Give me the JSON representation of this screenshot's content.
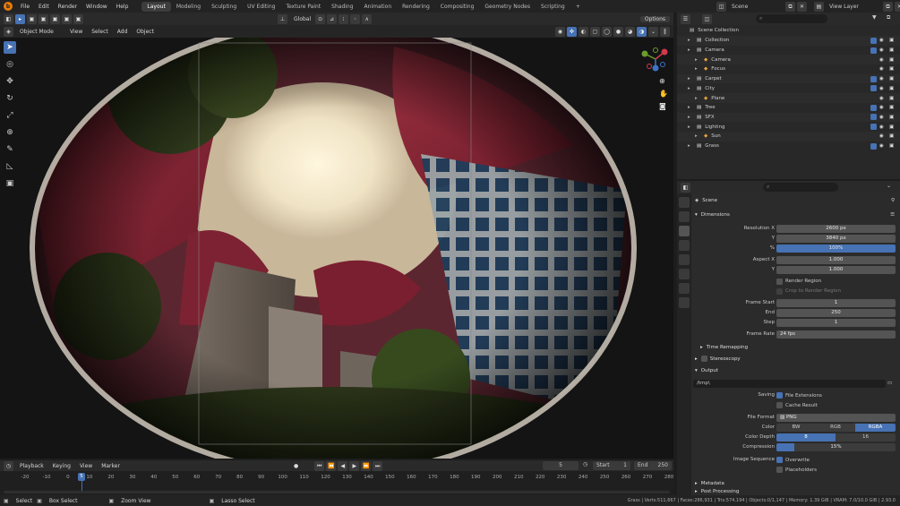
{
  "menu": {
    "items": [
      "File",
      "Edit",
      "Render",
      "Window",
      "Help"
    ]
  },
  "workspaces": [
    "Layout",
    "Modeling",
    "Sculpting",
    "UV Editing",
    "Texture Paint",
    "Shading",
    "Animation",
    "Rendering",
    "Compositing",
    "Geometry Nodes",
    "Scripting"
  ],
  "topright": {
    "scene": "Scene",
    "view_layer": "View Layer"
  },
  "viewport": {
    "orientation": "Global",
    "options_label": "Options",
    "mode": "Object Mode",
    "menus": [
      "View",
      "Select",
      "Add",
      "Object"
    ]
  },
  "outliner": {
    "root": "Scene Collection",
    "items": [
      {
        "label": "Collection",
        "depth": 1
      },
      {
        "label": "Camera",
        "depth": 1
      },
      {
        "label": "Camera",
        "depth": 2
      },
      {
        "label": "Focus",
        "depth": 2
      },
      {
        "label": "Carpet",
        "depth": 1
      },
      {
        "label": "City",
        "depth": 1
      },
      {
        "label": "Plane",
        "depth": 2
      },
      {
        "label": "Tree",
        "depth": 1
      },
      {
        "label": "SFX",
        "depth": 1
      },
      {
        "label": "Lighting",
        "depth": 1
      },
      {
        "label": "Sun",
        "depth": 2
      },
      {
        "label": "Grass",
        "depth": 1
      }
    ]
  },
  "properties": {
    "scene_label": "Scene",
    "dimensions": {
      "title": "Dimensions",
      "resolution_x_label": "Resolution X",
      "resolution_x": "2600 px",
      "y_label": "Y",
      "resolution_y": "3840 px",
      "percent_label": "%",
      "percent": "100%",
      "aspect_x_label": "Aspect X",
      "aspect_x": "1.000",
      "aspect_y_label": "Y",
      "aspect_y": "1.000",
      "render_region": "Render Region",
      "crop_region": "Crop to Render Region",
      "frame_start_label": "Frame Start",
      "frame_start": "1",
      "end_label": "End",
      "end": "250",
      "step_label": "Step",
      "step": "1",
      "frame_rate_label": "Frame Rate",
      "frame_rate": "24 fps",
      "time_remapping": "Time Remapping"
    },
    "stereoscopy": "Stereoscopy",
    "output": {
      "title": "Output",
      "path": "/tmp\\",
      "saving_label": "Saving",
      "file_extensions": "File Extensions",
      "cache_result": "Cache Result",
      "file_format_label": "File Format",
      "file_format": "PNG",
      "color_label": "Color",
      "color_options": [
        "BW",
        "RGB",
        "RGBA"
      ],
      "color_depth_label": "Color Depth",
      "color_depth": [
        "8",
        "16"
      ],
      "compression_label": "Compression",
      "compression": "15%",
      "image_sequence_label": "Image Sequence",
      "overwrite": "Overwrite",
      "placeholders": "Placeholders"
    },
    "metadata": "Metadata",
    "post_processing": "Post Processing"
  },
  "timeline": {
    "menus": [
      "Playback",
      "Keying",
      "View",
      "Marker"
    ],
    "current_frame": "5",
    "start_label": "Start",
    "start": "1",
    "end_label": "End",
    "end": "250",
    "ticks": [
      "-20",
      "-10",
      "0",
      "10",
      "20",
      "30",
      "40",
      "50",
      "60",
      "70",
      "80",
      "90",
      "100",
      "110",
      "120",
      "130",
      "140",
      "150",
      "160",
      "170",
      "180",
      "190",
      "200",
      "210",
      "220",
      "230",
      "240",
      "250",
      "260",
      "270",
      "280"
    ],
    "playhead": "5"
  },
  "statusbar": {
    "select": "Select",
    "box_select": "Box Select",
    "zoom_view": "Zoom View",
    "lasso_select": "Lasso Select",
    "stats": "Grass | Verts:511,667 | Faces:286,931 | Tris:574,194 | Objects:0/1,147 | Memory: 1.39 GiB | VRAM: 7.0/10.0 GiB | 2.93.0"
  },
  "colors": {
    "accent": "#4772b3",
    "brand": "#e87d0d"
  }
}
